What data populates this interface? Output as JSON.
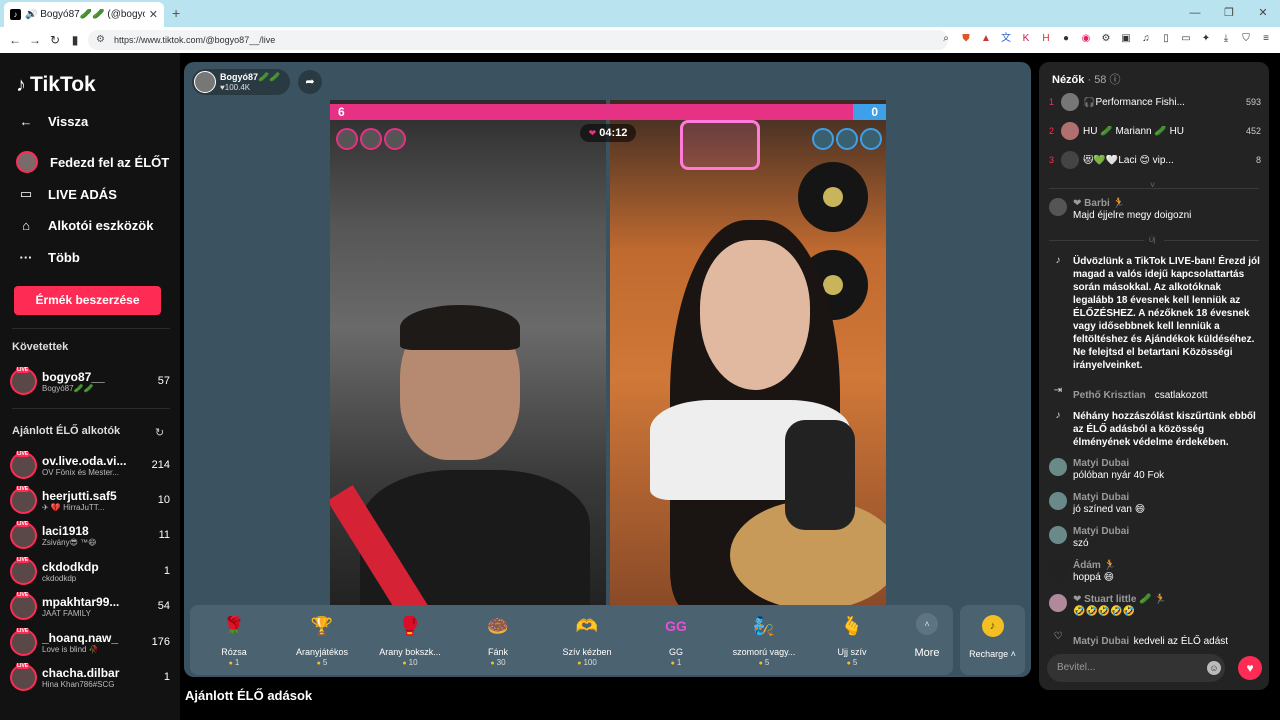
{
  "browser": {
    "tab_title": "🔊 Bogyó87🥒🥒 (@bogyo87_",
    "url": "https://www.tiktok.com/@bogyo87__/live"
  },
  "sidebar": {
    "logo": "TikTok",
    "menu": [
      {
        "label": "Vissza",
        "icon": "back-arrow-icon"
      },
      {
        "label": "Fedezd fel az ÉLŐT",
        "icon": "avatar-icon"
      },
      {
        "label": "LIVE ADÁS",
        "icon": "camera-icon"
      },
      {
        "label": "Alkotói eszközök",
        "icon": "creator-tools-icon"
      },
      {
        "label": "Több",
        "icon": "more-icon"
      }
    ],
    "coins_button": "Érmék beszerzése",
    "following_title": "Követettek",
    "following": [
      {
        "name": "bogyo87__",
        "sub": "Bogyó87🥒🥒",
        "count": "57"
      }
    ],
    "recommended_title": "Ajánlott ÉLŐ alkotók",
    "recommended": [
      {
        "name": "ov.live.oda.vi...",
        "sub": "OV Fönix és Mester...",
        "count": "214"
      },
      {
        "name": "heerjutti.saf5",
        "sub": "✈ 💔 HirraJuTT...",
        "count": "10"
      },
      {
        "name": "laci1918",
        "sub": "Zsivány😎 ™😄",
        "count": "11"
      },
      {
        "name": "ckdodkdp",
        "sub": "ckdodkdp",
        "count": "1"
      },
      {
        "name": "mpakhtar99...",
        "sub": "JAAT FAMILY",
        "count": "54"
      },
      {
        "name": "_hoanq.naw_",
        "sub": "Love is blind 🥀",
        "count": "176"
      },
      {
        "name": "chacha.dilbar",
        "sub": "Hina Khan786#SCG",
        "count": "1"
      }
    ]
  },
  "stream": {
    "host_name": "Bogyó87🥒🥒",
    "host_likes": "♥100.4K",
    "pk_left_score": "6",
    "pk_right_score": "0",
    "pk_left_fraction": 0.94,
    "timer": "04:12",
    "gifts": [
      {
        "name": "Rózsa",
        "price": "1",
        "icon": "🌹"
      },
      {
        "name": "Aranyjátékos",
        "price": "5",
        "icon": "🏆"
      },
      {
        "name": "Arany bokszk...",
        "price": "10",
        "icon": "🥊"
      },
      {
        "name": "Fánk",
        "price": "30",
        "icon": "🍩"
      },
      {
        "name": "Szív kézben",
        "price": "100",
        "icon": "🫶"
      },
      {
        "name": "GG",
        "price": "1",
        "icon": "GG"
      },
      {
        "name": "szomorú vagy...",
        "price": "5",
        "icon": "🧞"
      },
      {
        "name": "Ujj szív",
        "price": "5",
        "icon": "🫰"
      }
    ],
    "more_label": "More",
    "recharge_label": "Recharge ˄"
  },
  "below_title": "Ajánlott ÉLŐ adások",
  "chat": {
    "viewers_title": "Nézők",
    "viewers_count": "· 58",
    "top_viewers": [
      {
        "rank": "1",
        "name": "🎧Performance Fishi...",
        "score": "593"
      },
      {
        "rank": "2",
        "name": "HU 🥒 Mariann 🥒 HU",
        "score": "452"
      },
      {
        "rank": "3",
        "name": "😻💚🤍Laci 😊 vip...",
        "score": "8"
      }
    ],
    "new_label": "Új",
    "messages": [
      {
        "user": "❤ Barbi 🏃",
        "text": "Majd éjjelre megy doigozni"
      },
      {
        "user": "",
        "text": "Üdvözlünk a TikTok LIVE-ban! Érezd jól magad a valós idejű kapcsolattartás során másokkal. Az alkotóknak legalább 18 évesnek kell lenniük az ÉLŐZÉSHEZ. A nézőknek 18 évesnek vagy idősebbnek kell lenniük a feltöltéshez és Ajándékok küldéséhez. Ne felejtsd el betartani Közösségi irányelveinket."
      },
      {
        "user": "Pethő Krisztian",
        "text": "csatlakozott"
      },
      {
        "user": "",
        "text": "Néhány hozzászólást kiszűrtünk ebből az ÉLŐ adásból a közösség élményének védelme érdekében."
      },
      {
        "user": "Matyi Dubai",
        "text": "pólóban nyár 40 Fok"
      },
      {
        "user": "Matyi Dubai",
        "text": "jó színed van 😄"
      },
      {
        "user": "Matyi Dubai",
        "text": "szó"
      },
      {
        "user": "Ádám 🏃",
        "text": "hoppá 😄"
      },
      {
        "user": "❤ Stuart little 🥒 🏃",
        "text": "🤣🤣🤣🤣🤣"
      },
      {
        "user": "Matyi Dubai",
        "text": "kedveli az ÉLŐ adást"
      }
    ],
    "input_placeholder": "Bevitel..."
  }
}
